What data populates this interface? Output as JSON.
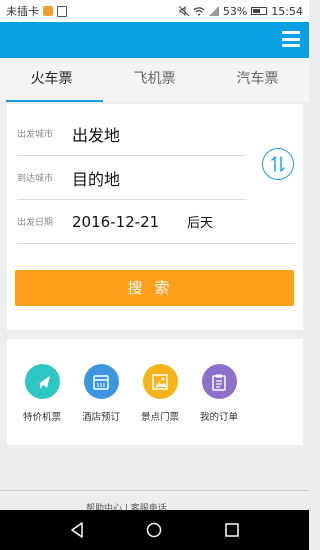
{
  "status_bar": {
    "carrier": "未插卡",
    "battery": "53%",
    "time": "15:54"
  },
  "tabs": [
    {
      "label": "火车票",
      "active": true
    },
    {
      "label": "飞机票",
      "active": false
    },
    {
      "label": "汽车票",
      "active": false
    }
  ],
  "form": {
    "from_label": "出发城市",
    "from_value": "出发地",
    "to_label": "到达城市",
    "to_value": "目的地",
    "date_label": "出发日期",
    "date_value": "2016-12-21",
    "date_relative": "后天",
    "search_label": "搜索"
  },
  "quick_links": [
    {
      "label": "特价机票",
      "icon": "plane-icon",
      "color": "#2ec5c5"
    },
    {
      "label": "酒店预订",
      "icon": "calendar-icon",
      "color": "#3c96e0"
    },
    {
      "label": "景点门票",
      "icon": "picture-icon",
      "color": "#f4b41a"
    },
    {
      "label": "我的订单",
      "icon": "clipboard-icon",
      "color": "#8c70cc"
    }
  ],
  "footer": {
    "text": "帮助中心 | 客服电话"
  },
  "colors": {
    "brand": "#0aa0e6",
    "search_button": "#ff9f1a"
  }
}
